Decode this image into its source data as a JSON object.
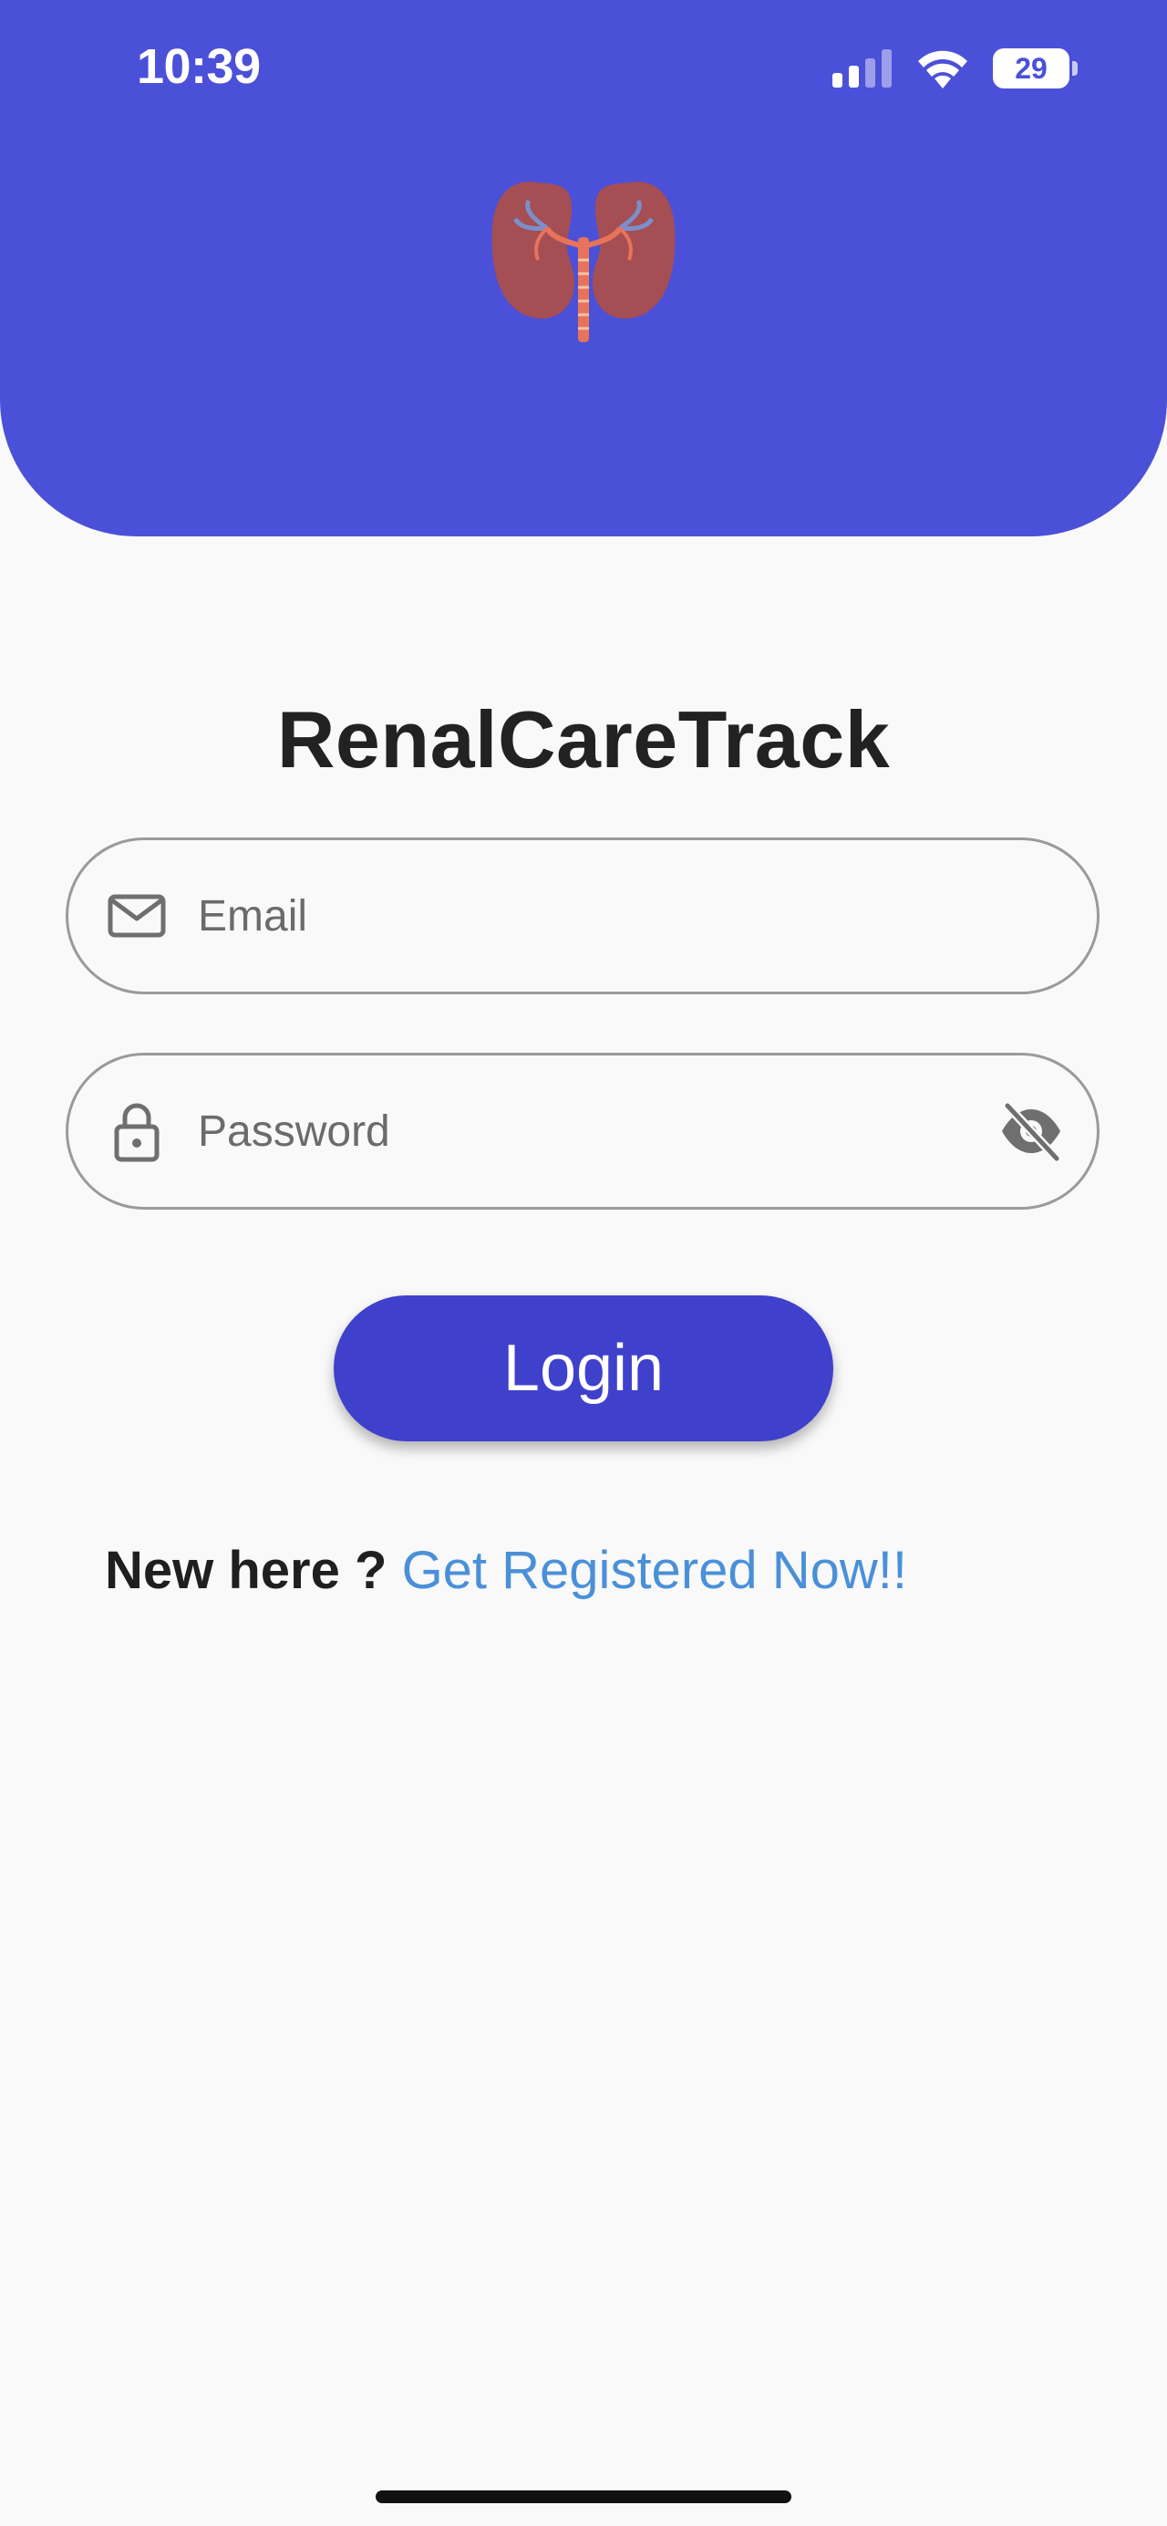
{
  "status_bar": {
    "time": "10:39",
    "battery": "29",
    "icons": [
      "cellular-signal-icon",
      "wifi-icon",
      "battery-icon"
    ]
  },
  "header": {
    "logo_icon": "kidneys-icon",
    "background_color": "#4b50d8"
  },
  "app": {
    "title": "RenalCareTrack"
  },
  "form": {
    "email": {
      "placeholder": "Email",
      "value": "",
      "icon": "mail-icon"
    },
    "password": {
      "placeholder": "Password",
      "value": "",
      "icon": "lock-icon",
      "toggle_icon": "eye-off-icon"
    },
    "login_label": "Login",
    "login_color": "#3f40cc"
  },
  "register": {
    "prompt": "New here ?",
    "link": "Get Registered Now!!",
    "link_color": "#4a90d9"
  }
}
